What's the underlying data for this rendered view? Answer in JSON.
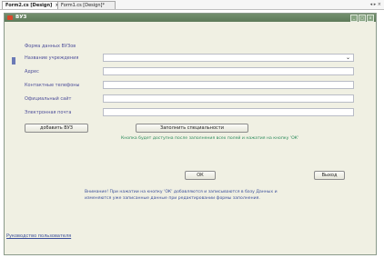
{
  "tabs": [
    {
      "label": "Form2.cs [Design]",
      "active": true
    },
    {
      "label": "Form1.cs [Design]*",
      "active": false
    }
  ],
  "tab_controls": "◂ ▸ ×",
  "window": {
    "title": "ВУЗ",
    "controls": [
      "_",
      "□",
      "x"
    ]
  },
  "form": {
    "header": "Форма данных ВУЗов",
    "labels": [
      "Название учреждения",
      "Адрес",
      "Контактные телефоны",
      "Официальный сайт",
      "Электронная почта"
    ],
    "fields": [
      {
        "value": "",
        "type": "select"
      },
      {
        "value": "",
        "type": "text"
      },
      {
        "value": "",
        "type": "text"
      },
      {
        "value": "",
        "type": "text"
      },
      {
        "value": "",
        "type": "text"
      }
    ]
  },
  "buttons": {
    "add": "добавить ВУЗ",
    "fill": "Заполнить специальности",
    "ok": "ОК",
    "exit": "Выход"
  },
  "notes": {
    "green": "Кнопка будет доступна после заполнения всех полей и нажатия на кнопку 'ОК'",
    "blue_line1": "Внимание! При нажатии на кнопку 'ОК' добавляются и записываются в базу Данных и",
    "blue_line2": "изменяются уже записанные данные при редактировании формы заполнения."
  },
  "footer_link": "Руководство пользователя"
}
